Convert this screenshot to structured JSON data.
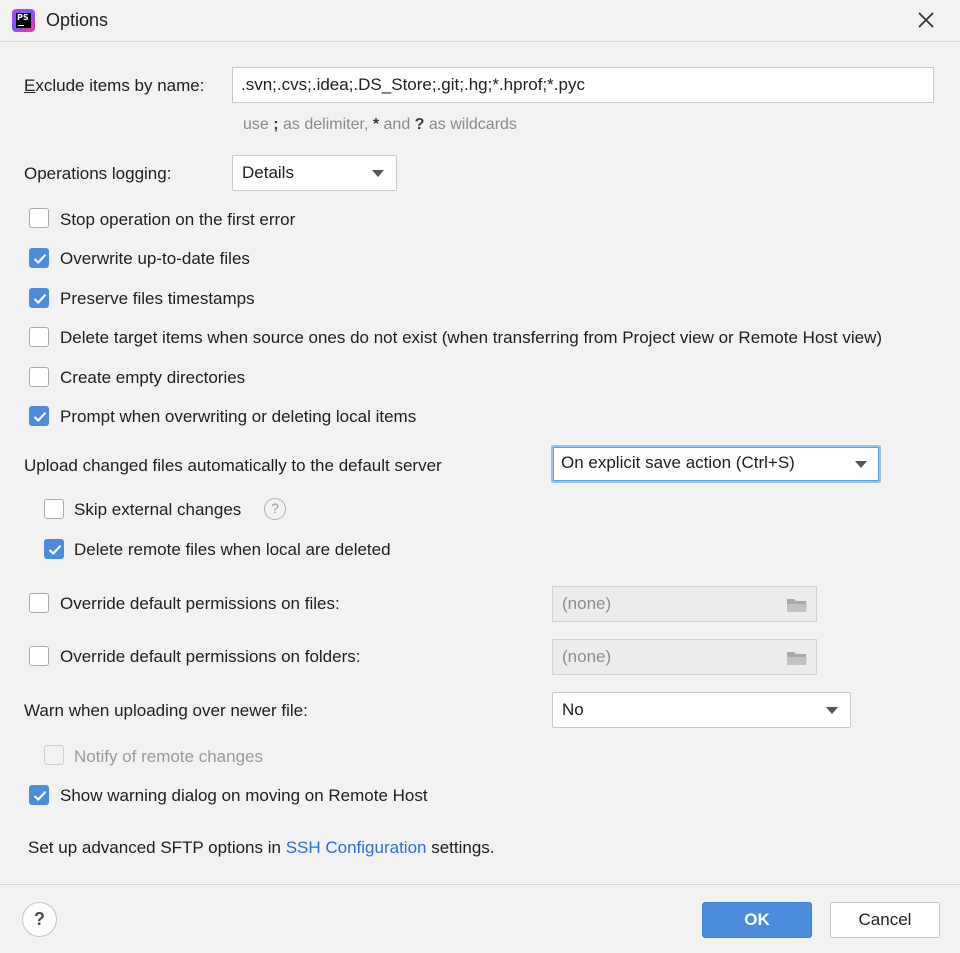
{
  "window": {
    "title": "Options",
    "app_icon_text": "PS"
  },
  "exclude": {
    "label": "Exclude items by name:",
    "label_mnemonic": "E",
    "label_rest": "xclude items by name:",
    "value": ".svn;.cvs;.idea;.DS_Store;.git;.hg;*.hprof;*.pyc",
    "hint_pre": "use ",
    "hint_semicolon": ";",
    "hint_mid": " as delimiter, ",
    "hint_star": "*",
    "hint_and": " and ",
    "hint_q": "?",
    "hint_post": " as wildcards"
  },
  "logging": {
    "label": "Operations logging:",
    "value": "Details"
  },
  "checkboxes": {
    "stop_on_error": {
      "label": "Stop operation on the first error",
      "checked": false
    },
    "overwrite_uptodate": {
      "label": "Overwrite up-to-date files",
      "checked": true
    },
    "preserve_timestamps": {
      "label": "Preserve files timestamps",
      "checked": true
    },
    "delete_target": {
      "label": "Delete target items when source ones do not exist (when transferring from Project view or Remote Host view)",
      "checked": false
    },
    "create_empty_dirs": {
      "label": "Create empty directories",
      "checked": false
    },
    "prompt_overwrite": {
      "label": "Prompt when overwriting or deleting local items",
      "checked": true
    }
  },
  "upload": {
    "label": "Upload changed files automatically to the default server",
    "value": "On explicit save action (Ctrl+S)",
    "skip_external": {
      "label": "Skip external changes",
      "checked": false
    },
    "delete_remote": {
      "label": "Delete remote files when local are deleted",
      "checked": true
    }
  },
  "permissions": {
    "files": {
      "label": "Override default permissions on files:",
      "value": "(none)",
      "checked": false
    },
    "folders": {
      "label": "Override default permissions on folders:",
      "value": "(none)",
      "checked": false
    }
  },
  "warn": {
    "label": "Warn when uploading over newer file:",
    "value": "No"
  },
  "notify_remote": {
    "label": "Notify of remote changes",
    "checked": false,
    "disabled": true
  },
  "show_warning": {
    "label": "Show warning dialog on moving on Remote Host",
    "checked": true
  },
  "sftp": {
    "pre": "Set up advanced SFTP options in ",
    "link": "SSH Configuration",
    "post": " settings."
  },
  "footer": {
    "help": "?",
    "ok": "OK",
    "cancel": "Cancel"
  },
  "colors": {
    "accent": "#4a8dde",
    "link": "#2f6fc6",
    "background": "#f2f2f2"
  }
}
